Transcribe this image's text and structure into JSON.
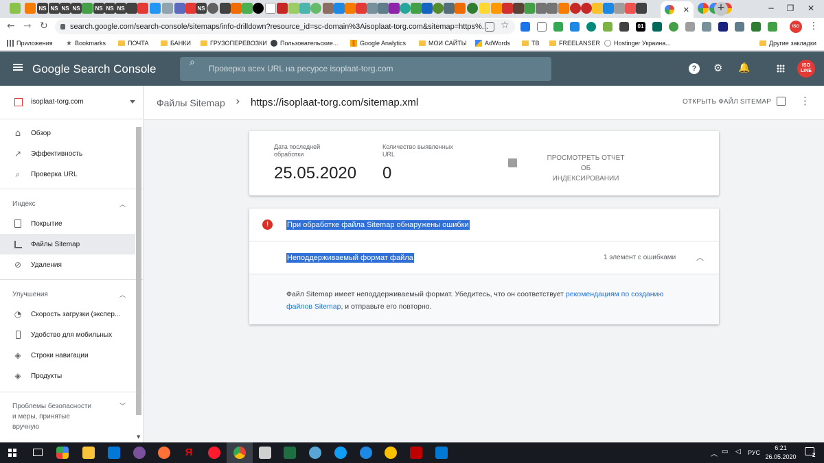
{
  "browser": {
    "tabs_strip": [
      "NS",
      "NS",
      "NS",
      "NS",
      "NS",
      "NS",
      "NS",
      "NS"
    ],
    "url": "search.google.com/search-console/sitemaps/info-drilldown?resource_id=sc-domain%3Aisoplaat-torg.com&sitemap=https%...",
    "bookmarks": [
      {
        "label": "Приложения"
      },
      {
        "label": "Bookmarks"
      },
      {
        "label": "ПОЧТА"
      },
      {
        "label": "БАНКИ"
      },
      {
        "label": "ГРУЗОПЕРЕВОЗКИ"
      },
      {
        "label": "Пользовательские..."
      },
      {
        "label": "Google Analytics"
      },
      {
        "label": "МОИ САЙТЫ"
      },
      {
        "label": "AdWords"
      },
      {
        "label": "ТВ"
      },
      {
        "label": "FREELANSER"
      },
      {
        "label": "Hostinger Украина..."
      }
    ],
    "other_bookmarks": "Другие закладки",
    "ext_labels": [
      "01",
      "ISO"
    ]
  },
  "gsc": {
    "brand": "Google Search Console",
    "search_placeholder": "Проверка всех URL на ресурсе isoplaat-torg.com",
    "avatar_text": "ISO LINE"
  },
  "sidebar": {
    "property": "isoplaat-torg.com",
    "items_top": [
      {
        "label": "Обзор",
        "icon": "home-icon"
      },
      {
        "label": "Эффективность",
        "icon": "trending-icon"
      },
      {
        "label": "Проверка URL",
        "icon": "search-icon"
      }
    ],
    "section_index": "Индекс",
    "items_index": [
      {
        "label": "Покрытие",
        "icon": "coverage-icon"
      },
      {
        "label": "Файлы Sitemap",
        "icon": "sitemap-icon"
      },
      {
        "label": "Удаления",
        "icon": "removals-icon"
      }
    ],
    "section_enh": "Улучшения",
    "items_enh": [
      {
        "label": "Скорость загрузки (экспер...",
        "icon": "speed-icon"
      },
      {
        "label": "Удобство для мобильных",
        "icon": "mobile-icon"
      },
      {
        "label": "Строки навигации",
        "icon": "layers-icon"
      },
      {
        "label": "Продукты",
        "icon": "layers-icon"
      }
    ],
    "section_security": [
      "Проблемы безопасности",
      "и меры, принятые",
      "вручную"
    ]
  },
  "topbar": {
    "breadcrumb_parent": "Файлы Sitemap",
    "breadcrumb_current": "https://isoplaat-torg.com/sitemap.xml",
    "open_sitemap": "ОТКРЫТЬ ФАЙЛ SITEMAP"
  },
  "summary": {
    "date_label_1": "Дата последней",
    "date_label_2": "обработки",
    "date_value": "25.05.2020",
    "urls_label_1": "Количество выявленных",
    "urls_label_2": "URL",
    "urls_value": "0",
    "report_link_1": "ПРОСМОТРЕТЬ ОТЧЕТ ОБ",
    "report_link_2": "ИНДЕКСИРОВАНИИ"
  },
  "errors": {
    "title": "При обработке файла Sitemap обнаружены ошибки",
    "type": "Неподдерживаемый формат файла",
    "count": "1 элемент с ошибками",
    "desc_before": "Файл Sitemap имеет неподдерживаемый формат. Убедитесь, что он соответствует ",
    "desc_link_1": "рекомендациям по созданию",
    "desc_link_2": "файлов Sitemap",
    "desc_after": ", и отправьте его повторно."
  },
  "taskbar": {
    "lang": "РУС",
    "time": "6:21",
    "date": "26.05.2020",
    "notif_count": "2"
  },
  "colors": {
    "header": "#455a64",
    "error_red": "#d93025",
    "link_blue": "#1a73e8",
    "selection": "#2f6fd8"
  }
}
